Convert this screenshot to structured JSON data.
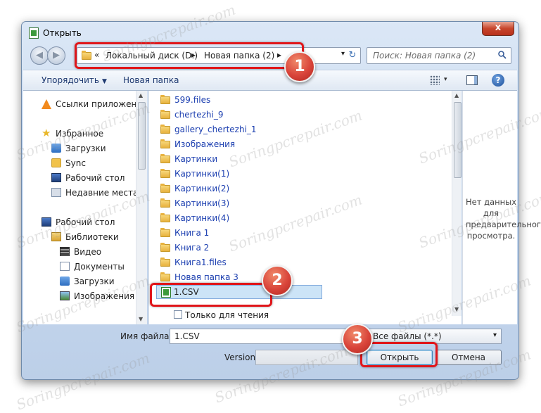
{
  "window": {
    "title": "Открыть",
    "close_glyph": "x"
  },
  "addressbar": {
    "prefix": "«",
    "crumbs": [
      "Локальный диск (D:)",
      "Новая папка (2)"
    ],
    "separator": "▸",
    "dropdown": "▾",
    "refresh": "↻"
  },
  "search": {
    "placeholder": "Поиск: Новая папка (2)"
  },
  "toolbar": {
    "organize": "Упорядочить",
    "organize_caret": "▼",
    "new_folder": "Новая папка",
    "views_caret": "▾",
    "help": "?"
  },
  "nav": {
    "items": [
      {
        "label": "Ссылки приложени",
        "icon": "vlc-cone-icon"
      },
      {
        "label": "Избранное",
        "icon": "star-icon"
      },
      {
        "label": "Загрузки",
        "icon": "downloads-icon"
      },
      {
        "label": "Sync",
        "icon": "sync-folder-icon"
      },
      {
        "label": "Рабочий стол",
        "icon": "desktop-icon"
      },
      {
        "label": "Недавние места",
        "icon": "recent-places-icon"
      },
      {
        "label": "Рабочий стол",
        "icon": "desktop-icon"
      },
      {
        "label": "Библиотеки",
        "icon": "library-icon"
      },
      {
        "label": "Видео",
        "icon": "video-icon"
      },
      {
        "label": "Документы",
        "icon": "documents-icon"
      },
      {
        "label": "Загрузки",
        "icon": "downloads-icon"
      },
      {
        "label": "Изображения",
        "icon": "images-icon"
      }
    ]
  },
  "files": {
    "folders": [
      "599.files",
      "chertezhi_9",
      "gallery_chertezhi_1",
      "Изображения",
      "Картинки",
      "Картинки(1)",
      "Картинки(2)",
      "Картинки(3)",
      "Картинки(4)",
      "Книга 1",
      "Книга 2",
      "Книга1.files",
      "Новая папка 3"
    ],
    "selected_file": "1.CSV"
  },
  "readonly": {
    "label": "Только для чтения"
  },
  "preview": {
    "text": "Нет данных для предварительного просмотра."
  },
  "bottom": {
    "filename_label": "Имя файла:",
    "filename_value": "1.CSV",
    "filter_value": "Все файлы (*.*)",
    "filter_caret": "▾",
    "version_label": "Version",
    "open_label": "Открыть",
    "cancel_label": "Отмена"
  },
  "annotations": {
    "step1": "1",
    "step2": "2",
    "step3": "3",
    "highlight_color": "#e0161a"
  },
  "watermark": "Soringpcrepair.com"
}
